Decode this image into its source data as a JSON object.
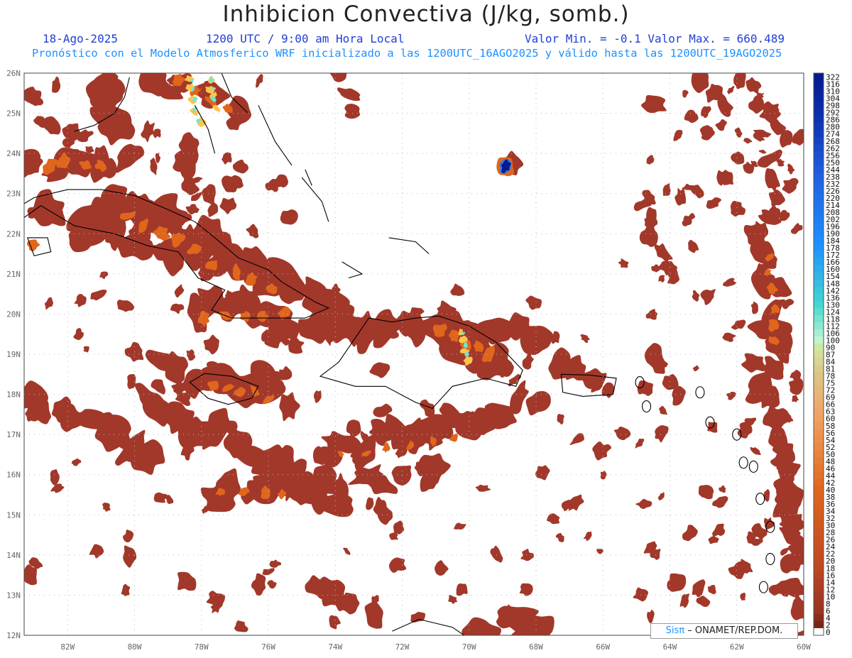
{
  "header": {
    "title": "Inhibicion Convectiva (J/kg, somb.)",
    "date": "18-Ago-2025",
    "time": "1200 UTC / 9:00 am Hora Local",
    "min_max": "Valor Min. = -0.1  Valor Max. = 660.489",
    "forecast": "Pronóstico con el Modelo Atmosferico WRF inicializado a las 1200UTC_16AGO2025 y válido hasta las  1200UTC_19AGO2025"
  },
  "map": {
    "lon_range": [
      -83.3,
      -60
    ],
    "lat_range": [
      12,
      26
    ],
    "lon_labels": [
      "82W",
      "80W",
      "78W",
      "76W",
      "74W",
      "72W",
      "70W",
      "68W",
      "66W",
      "64W",
      "62W",
      "60W"
    ],
    "lat_labels": [
      "26N",
      "25N",
      "24N",
      "23N",
      "22N",
      "21N",
      "20N",
      "19N",
      "18N",
      "17N",
      "16N",
      "15N",
      "14N",
      "13N",
      "12N"
    ],
    "field_color": "#a2382a",
    "colors": {
      "low": "#9a3322",
      "mid": "#e0661c",
      "high": "#ffc44a",
      "cyan": "#6ce8d8",
      "deep_blue": "#061a8f"
    }
  },
  "colorbar": {
    "labels": [
      "322",
      "316",
      "310",
      "304",
      "298",
      "292",
      "286",
      "280",
      "274",
      "268",
      "262",
      "256",
      "250",
      "244",
      "238",
      "232",
      "226",
      "220",
      "214",
      "208",
      "202",
      "196",
      "190",
      "184",
      "178",
      "172",
      "166",
      "160",
      "154",
      "148",
      "142",
      "136",
      "130",
      "124",
      "118",
      "112",
      "106",
      "100",
      "90",
      "87",
      "84",
      "81",
      "78",
      "75",
      "72",
      "69",
      "66",
      "63",
      "60",
      "58",
      "56",
      "54",
      "52",
      "50",
      "48",
      "46",
      "44",
      "42",
      "40",
      "38",
      "36",
      "34",
      "32",
      "30",
      "28",
      "26",
      "24",
      "22",
      "20",
      "18",
      "16",
      "14",
      "12",
      "10",
      "8",
      "6",
      "4",
      "2",
      "0"
    ]
  },
  "credit": {
    "brand": "Sisπ",
    "text": "– ONAMET/REP.DOM."
  }
}
